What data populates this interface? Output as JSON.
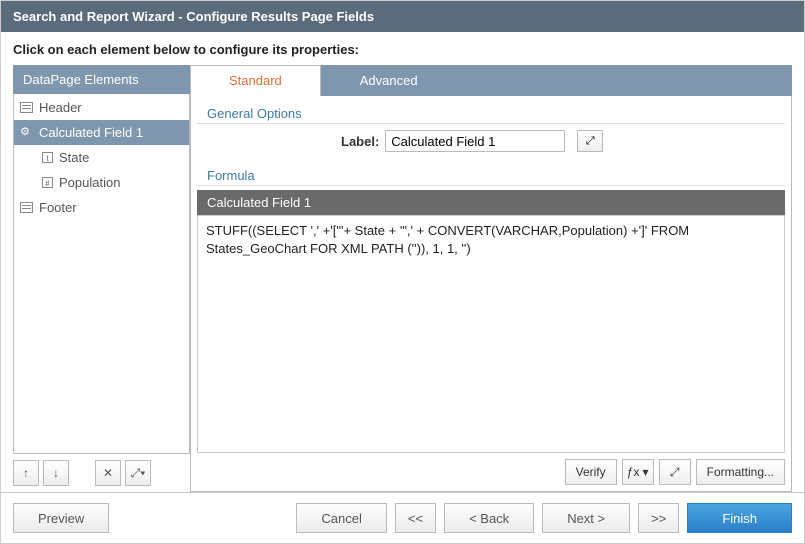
{
  "title": "Search and Report Wizard - Configure Results Page Fields",
  "instruction": "Click on each element below to configure its properties:",
  "leftPanel": {
    "header": "DataPage Elements",
    "items": [
      {
        "label": "Header",
        "type": "header"
      },
      {
        "label": "Calculated Field 1",
        "type": "calc",
        "selected": true
      },
      {
        "label": "State",
        "type": "text",
        "indent": true
      },
      {
        "label": "Population",
        "type": "num",
        "indent": true
      },
      {
        "label": "Footer",
        "type": "header"
      }
    ]
  },
  "tabs": {
    "standard": "Standard",
    "advanced": "Advanced"
  },
  "generalOptions": {
    "section": "General Options",
    "labelText": "Label:",
    "labelValue": "Calculated Field 1"
  },
  "formula": {
    "section": "Formula",
    "header": "Calculated Field 1",
    "body": "STUFF((SELECT ',' +'[\"'+ State + '\",' + CONVERT(VARCHAR,Population) +']' FROM States_GeoChart FOR XML PATH ('')), 1, 1, '')"
  },
  "rightToolbar": {
    "verify": "Verify",
    "fx": "ƒx",
    "formatting": "Formatting..."
  },
  "footer": {
    "preview": "Preview",
    "cancel": "Cancel",
    "first": "<<",
    "back": "< Back",
    "next": "Next >",
    "last": ">>",
    "finish": "Finish"
  }
}
